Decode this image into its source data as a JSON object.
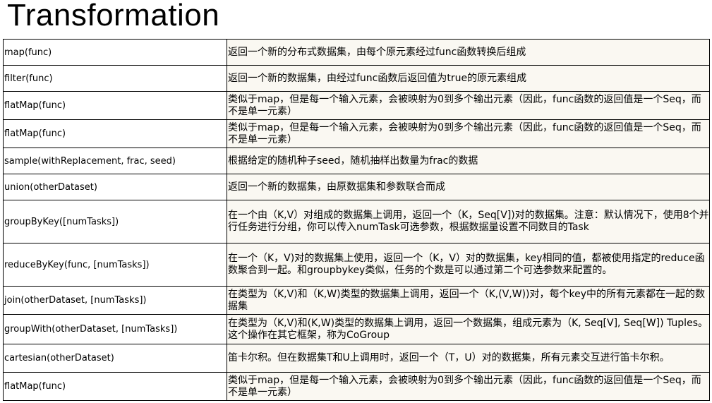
{
  "title": "Transformation",
  "rows": [
    {
      "op": "map(func)",
      "desc": "返回一个新的分布式数据集，由每个原元素经过func函数转换后组成"
    },
    {
      "op": "filter(func)",
      "desc": "返回一个新的数据集，由经过func函数后返回值为true的原元素组成"
    },
    {
      "op": "flatMap(func)",
      "desc": "类似于map，但是每一个输入元素，会被映射为0到多个输出元素（因此，func函数的返回值是一个Seq，而不是单一元素）"
    },
    {
      "op": "flatMap(func)",
      "desc": "类似于map，但是每一个输入元素，会被映射为0到多个输出元素（因此，func函数的返回值是一个Seq，而不是单一元素）"
    },
    {
      "op": "sample(withReplacement,  frac, seed)",
      "desc": "根据给定的随机种子seed，随机抽样出数量为frac的数据"
    },
    {
      "op": "union(otherDataset)",
      "desc": "返回一个新的数据集，由原数据集和参数联合而成"
    },
    {
      "op": "groupByKey([numTasks])",
      "desc": "在一个由（K,V）对组成的数据集上调用，返回一个（K，Seq[V])对的数据集。注意：默认情况下，使用8个并行任务进行分组，你可以传入numTask可选参数，根据数据量设置不同数目的Task"
    },
    {
      "op": "reduceByKey(func,  [numTasks])",
      "desc": "在一个（K，V)对的数据集上使用，返回一个（K，V）对的数据集，key相同的值，都被使用指定的reduce函数聚合到一起。和groupbykey类似，任务的个数是可以通过第二个可选参数来配置的。"
    },
    {
      "op": "join(otherDataset,  [numTasks])",
      "desc": "在类型为（K,V)和（K,W)类型的数据集上调用，返回一个（K,(V,W))对，每个key中的所有元素都在一起的数据集"
    },
    {
      "op": "groupWith(otherDataset,  [numTasks])",
      "desc": "在类型为（K,V)和(K,W)类型的数据集上调用，返回一个数据集，组成元素为（K, Seq[V], Seq[W]) Tuples。这个操作在其它框架，称为CoGroup"
    },
    {
      "op": "cartesian(otherDataset)",
      "desc": "笛卡尔积。但在数据集T和U上调用时，返回一个（T，U）对的数据集，所有元素交互进行笛卡尔积。"
    },
    {
      "op": "flatMap(func)",
      "desc": "类似于map，但是每一个输入元素，会被映射为0到多个输出元素（因此，func函数的返回值是一个Seq，而不是单一元素）"
    }
  ]
}
